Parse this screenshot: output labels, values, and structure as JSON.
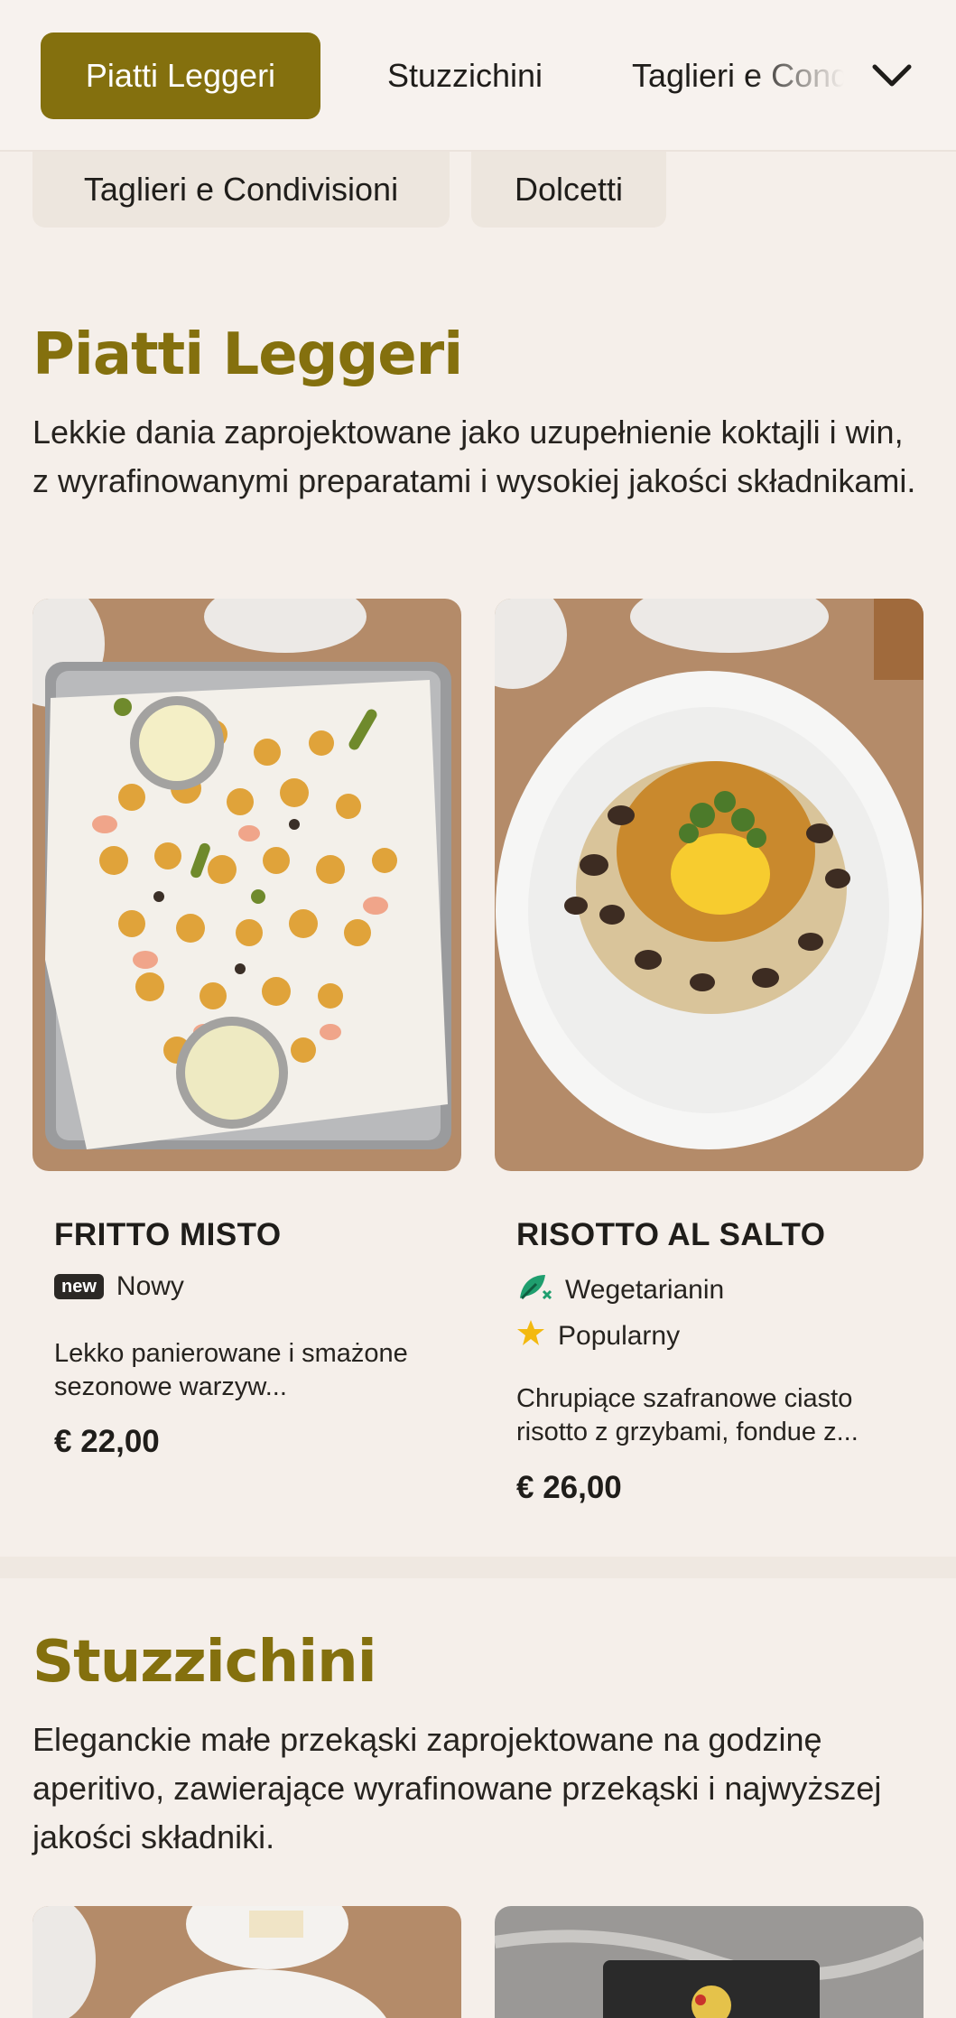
{
  "nav": {
    "tabs": [
      {
        "label": "Piatti Leggeri",
        "active": true
      },
      {
        "label": "Stuzzichini",
        "active": false
      },
      {
        "label": "Taglieri e Condivisioni",
        "active": false
      }
    ],
    "expand_icon": "chevron-down-icon",
    "chips": [
      {
        "label": "Taglieri e Condivisioni"
      },
      {
        "label": "Dolcetti"
      }
    ],
    "accent_color": "#84700e"
  },
  "sections": [
    {
      "title": "Piatti Leggeri",
      "description": "Lekkie dania zaprojektowane jako uzupełnienie koktajli i win, z wyrafinowanymi preparatami i wysokiej jakości składnikami.",
      "items": [
        {
          "name": "FRITTO MISTO",
          "tags": [
            {
              "type": "new",
              "badge": "new",
              "label": "Nowy"
            }
          ],
          "description": "Lekko panierowane i smażone sezonowe warzyw...",
          "price": "€ 22,00"
        },
        {
          "name": "RISOTTO AL SALTO",
          "tags": [
            {
              "type": "vegetarian",
              "icon": "leaf-icon",
              "label": "Wegetarianin"
            },
            {
              "type": "popular",
              "icon": "star-icon",
              "label": "Popularny"
            }
          ],
          "description": "Chrupiące szafranowe ciasto risotto z grzybami, fondue z...",
          "price": "€ 26,00"
        }
      ]
    },
    {
      "title": "Stuzzichini",
      "description": "Eleganckie małe przekąski zaprojektowane na godzinę aperitivo, zawierające wyrafinowane przekąski i najwyższej jakości składniki."
    }
  ]
}
